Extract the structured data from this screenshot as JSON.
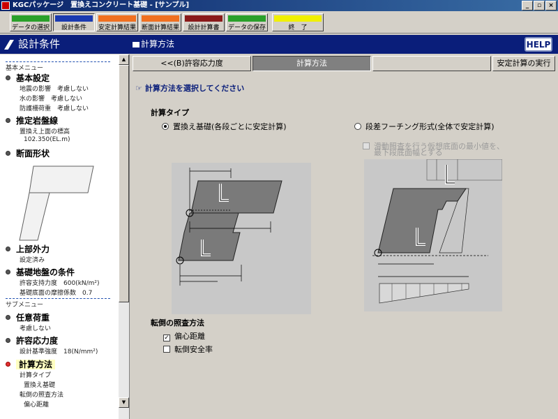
{
  "window": {
    "title": "KGCパッケージ　置換えコンクリート基礎 - [サンプル]",
    "min": "_",
    "max": "▫",
    "close": "×"
  },
  "toolbar": {
    "buttons": [
      {
        "label": "データの選択",
        "color": "#2aa02a"
      },
      {
        "label": "設計条件",
        "color": "#1a3ab0"
      },
      {
        "label": "安定計算結果",
        "color": "#f07020"
      },
      {
        "label": "断面計算結果",
        "color": "#f07020"
      },
      {
        "label": "設計計算書",
        "color": "#8a1a1a"
      },
      {
        "label": "データの保存",
        "color": "#2aa02a"
      },
      {
        "label": "終　了",
        "color": "#f0f000"
      }
    ]
  },
  "left": {
    "header": "設計条件",
    "basic_menu": "基本メニュー",
    "sub_menu": "サブメニュー",
    "sections": {
      "basic": {
        "title": "基本設定",
        "items": [
          "地震の影響　考慮しない",
          "水の影響　考慮しない",
          "防護柵荷重　考慮しない"
        ]
      },
      "rock": {
        "title": "推定岩盤線",
        "items": [
          "置換え上面の標高",
          "102.350(EL.m)"
        ]
      },
      "section": {
        "title": "断面形状"
      },
      "upper": {
        "title": "上部外力",
        "items": [
          "設定済み"
        ]
      },
      "ground": {
        "title": "基礎地盤の条件",
        "items": [
          "許容支持力度　600(kN/m²)",
          "基礎底面の摩擦係数　0.7"
        ]
      },
      "load": {
        "title": "任意荷重",
        "items": [
          "考慮しない"
        ]
      },
      "allow": {
        "title": "許容応力度",
        "items": [
          "設計基準強度　18(N/mm²)"
        ]
      },
      "method": {
        "title": "計算方法",
        "items": [
          "計算タイプ",
          "置換え基礎",
          "転倒の照査方法",
          "偏心距離"
        ]
      }
    }
  },
  "main": {
    "header": "計算方法",
    "help": "HELP",
    "tabs": {
      "prev": "<<(B)許容応力度",
      "current": "計算方法",
      "next": "",
      "run": "安定計算の実行"
    },
    "prompt": "計算方法を選択してください",
    "calc_type": {
      "label": "計算タイプ",
      "option1": "置換え基礎(各段ごとに安定計算)",
      "option2": "段差フーチング形式(全体で安定計算)",
      "slide_check_line1": "滑動照査を行う仮想底面の最小値を、",
      "slide_check_line2": "最下段底面幅とする"
    },
    "overturn": {
      "label": "転倒の照査方法",
      "opt1": "偏心距離",
      "opt2": "転倒安全率"
    }
  }
}
